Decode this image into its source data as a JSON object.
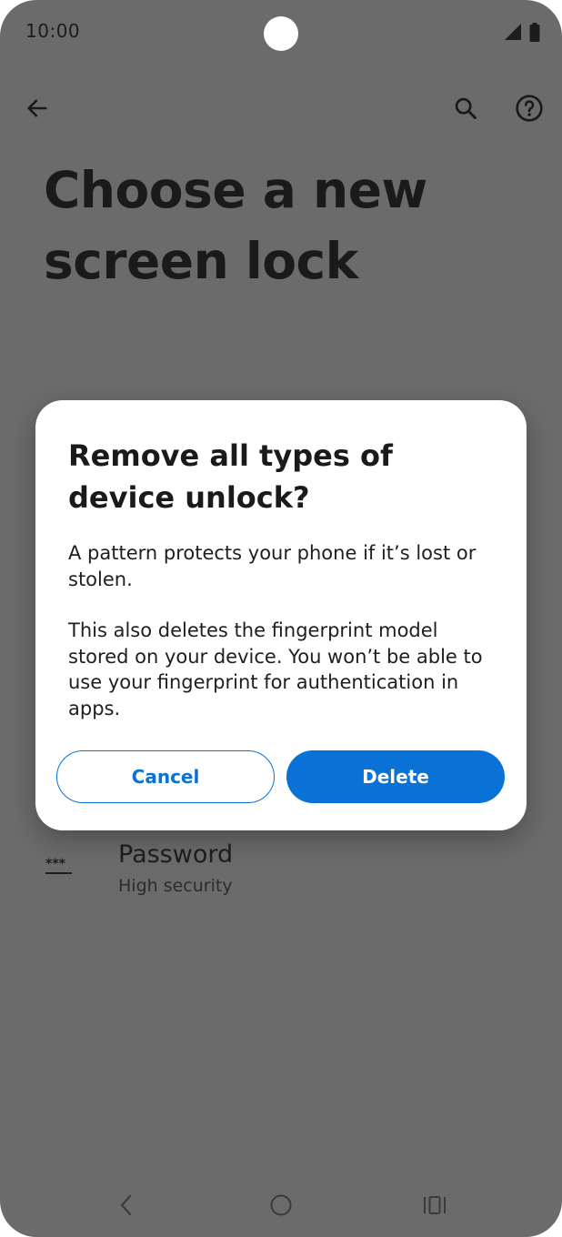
{
  "status_bar": {
    "time": "10:00"
  },
  "app_bar": {
    "back_icon": "arrow-left-icon",
    "search_icon": "search-icon",
    "help_icon": "help-circle-icon"
  },
  "page": {
    "title": "Choose a new screen lock"
  },
  "list": {
    "items": [
      {
        "icon": "password-icon",
        "title": "Password",
        "subtitle": "High security"
      }
    ]
  },
  "dialog": {
    "title": "Remove all types of device unlock?",
    "body_1": "A pattern protects your phone if it’s lost or stolen.",
    "body_2": "This also deletes the fingerprint model stored on your device. You won’t be able to use your fingerprint for authentication in apps.",
    "cancel_label": "Cancel",
    "delete_label": "Delete"
  },
  "nav_bar": {
    "back_icon": "nav-back-icon",
    "home_icon": "nav-home-icon",
    "recents_icon": "nav-recents-icon"
  },
  "colors": {
    "scrim": "#6b6b6b",
    "accent": "#0a72d6",
    "dialog_bg": "#ffffff"
  }
}
